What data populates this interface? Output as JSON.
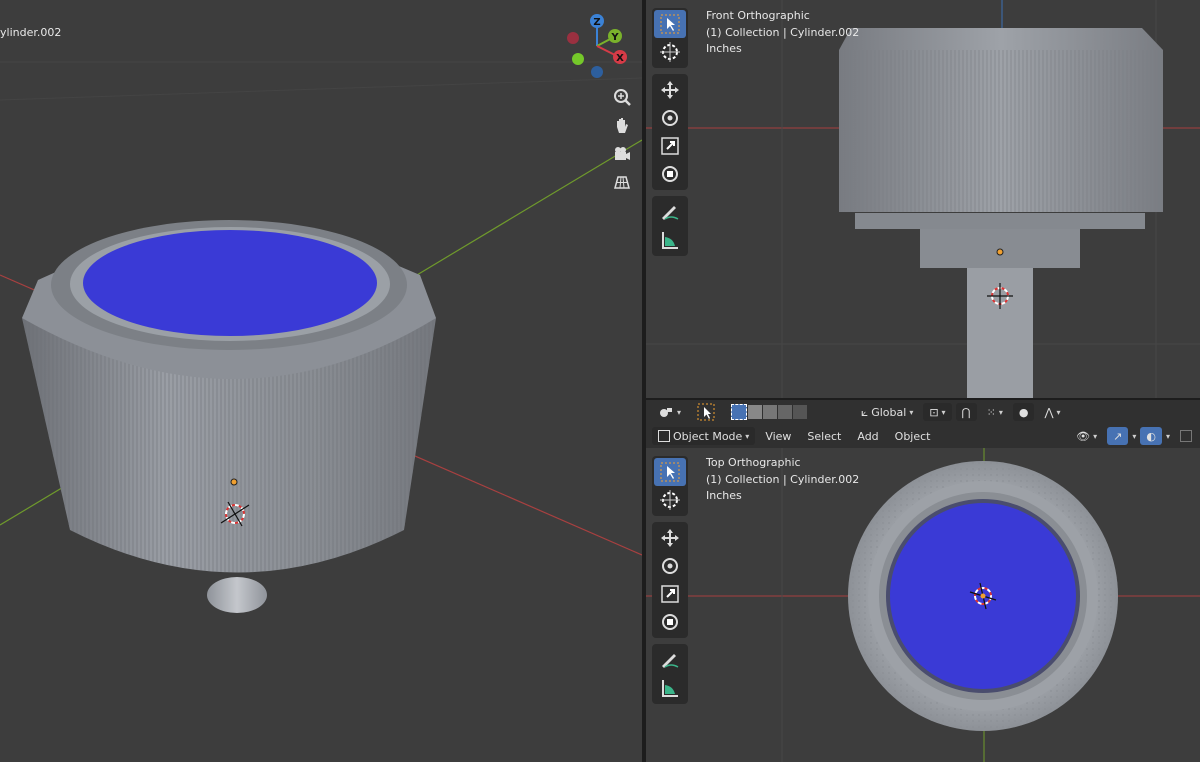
{
  "perspective_view": {
    "object_label": "ylinder.002",
    "gizmo_axes": {
      "z": "Z",
      "y": "Y",
      "x": "X"
    },
    "nav_icons": [
      "zoom-icon",
      "pan-hand-icon",
      "camera-icon",
      "ortho-grid-icon"
    ]
  },
  "front_view": {
    "view_name": "Front Orthographic",
    "collection_line": "(1) Collection | Cylinder.002",
    "units": "Inches"
  },
  "top_view": {
    "view_name": "Top Orthographic",
    "collection_line": "(1) Collection | Cylinder.002",
    "units": "Inches"
  },
  "header": {
    "transform_orientation": "Global",
    "mode": "Object Mode",
    "menus": {
      "view": "View",
      "select": "Select",
      "add": "Add",
      "object": "Object"
    }
  },
  "toolbar": {
    "tools": [
      "select-box",
      "cursor",
      "move",
      "rotate",
      "scale",
      "transform",
      "annotate",
      "measure"
    ],
    "active_tool": "select-box"
  },
  "colors": {
    "background": "#3d3d3d",
    "cap_blue": "#3a3ad6",
    "body_gray": "#8e9299",
    "x_axis": "#c14848",
    "y_axis": "#6f9a2c",
    "accent": "#4772b3"
  }
}
